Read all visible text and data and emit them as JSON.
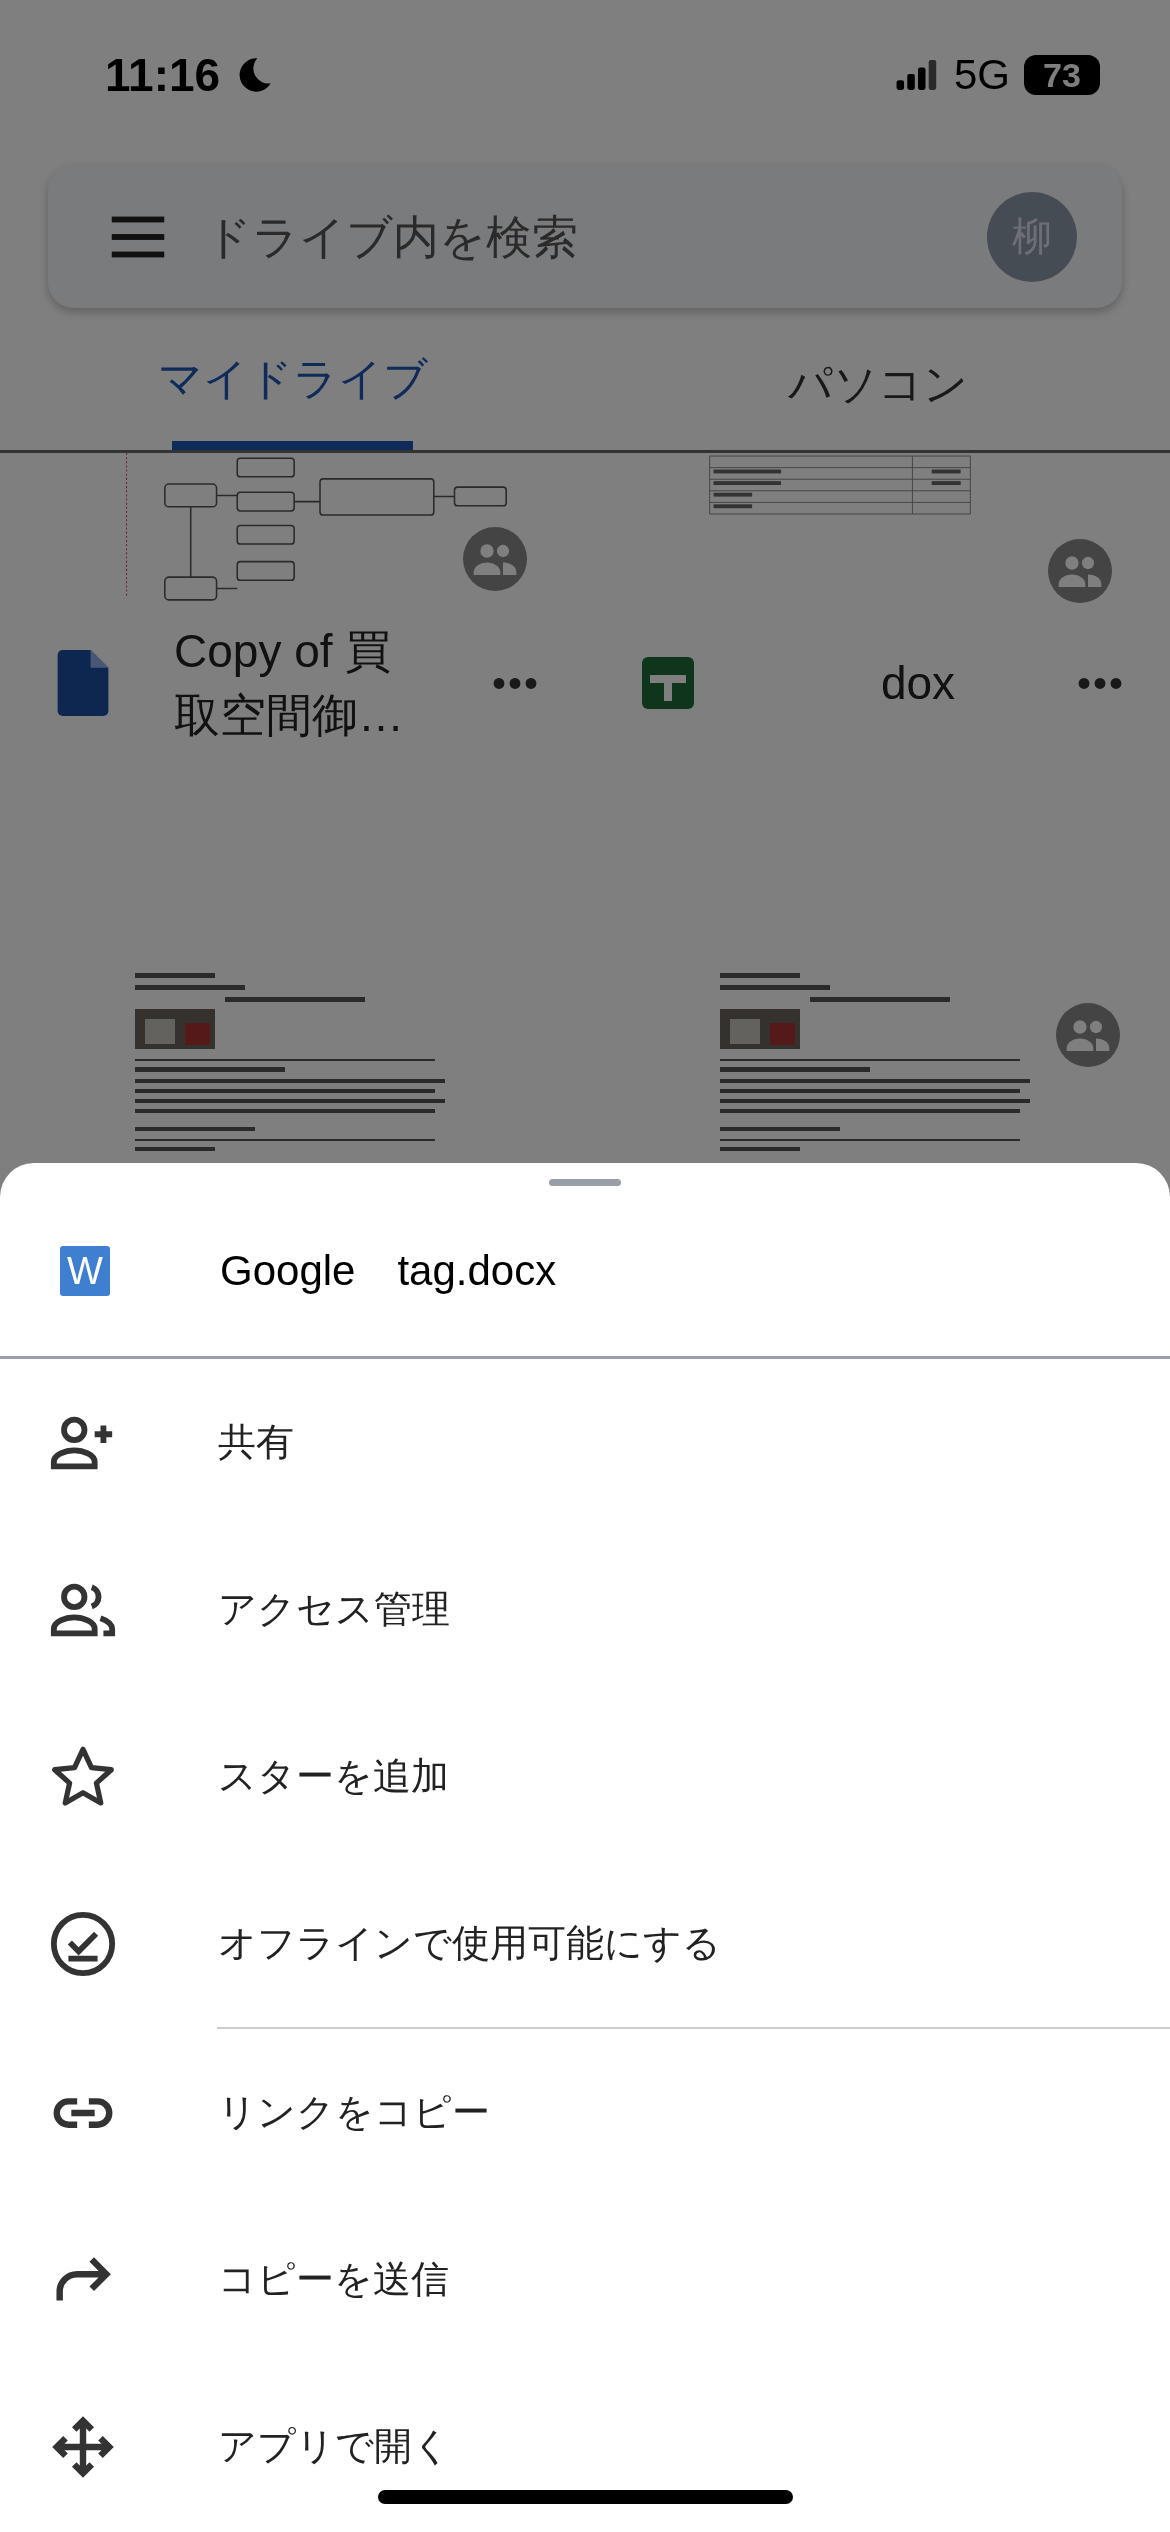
{
  "status_bar": {
    "time": "11:16",
    "network": "5G",
    "battery": "73"
  },
  "search": {
    "placeholder": "ドライブ内を検索",
    "avatar": "柳"
  },
  "tabs": [
    {
      "label": "マイドライブ",
      "selected": true
    },
    {
      "label": "パソコン",
      "selected": false
    }
  ],
  "files": [
    {
      "thumbnail": {
        "kind": "diagram",
        "shared": true
      },
      "kind": "doc",
      "name_lines": [
        "Copy of 買",
        "取空間御…"
      ],
      "more": "•••"
    },
    {
      "thumbnail": {
        "kind": "table",
        "shared": true
      },
      "kind": "sheet",
      "name_lines": [
        "dox"
      ],
      "more": "•••"
    },
    {
      "thumbnail": {
        "kind": "text",
        "shared": false
      }
    },
    {
      "thumbnail": {
        "kind": "text",
        "shared": true
      }
    }
  ],
  "sheet": {
    "file_icon": "W",
    "file_name": "Google　tag.docx",
    "actions": [
      {
        "kind": "person-add",
        "label": "共有",
        "divider": false
      },
      {
        "kind": "people",
        "label": "アクセス管理",
        "divider": false
      },
      {
        "kind": "star",
        "label": "スターを追加",
        "divider": false
      },
      {
        "kind": "offline",
        "label": "オフラインで使用可能にする",
        "divider": true
      },
      {
        "kind": "link",
        "label": "リンクをコピー",
        "divider": false
      },
      {
        "kind": "send",
        "label": "コピーを送信",
        "divider": false
      },
      {
        "kind": "move",
        "label": "アプリで開く",
        "divider": false
      }
    ]
  }
}
